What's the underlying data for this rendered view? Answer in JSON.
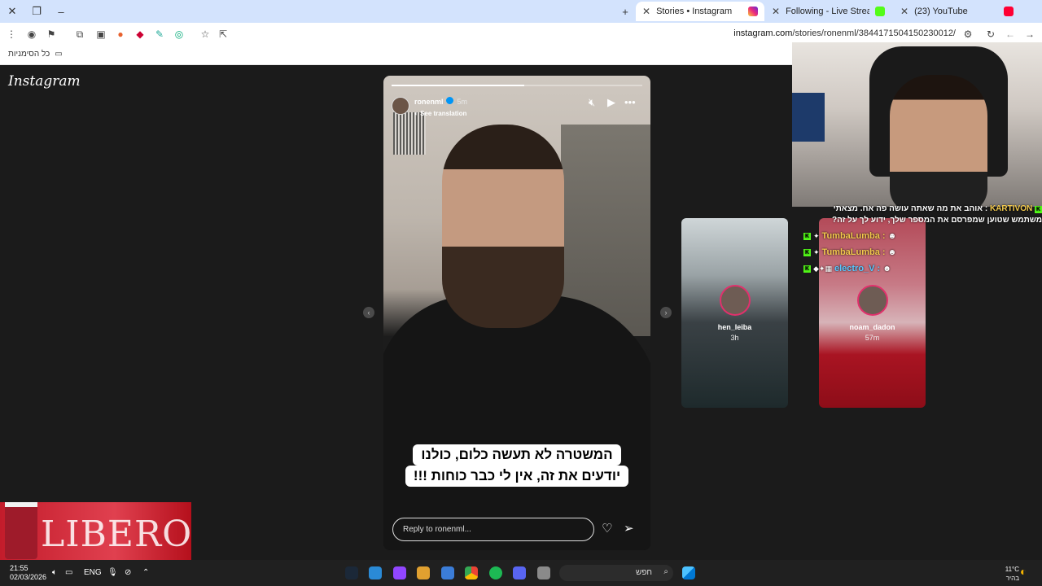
{
  "browser": {
    "tabs": [
      {
        "title": "Stories • Instagram",
        "active": true
      },
      {
        "title": "Following - Live Streams on Kic",
        "active": false
      },
      {
        "title": "(23) YouTube",
        "active": false
      }
    ],
    "new_tab_label": "+",
    "url_domain": "instagram.com",
    "url_path": "/stories/ronenml/3844171504150230012/",
    "bookmarks_label": "כל הסימניות"
  },
  "instagram": {
    "logo": "Instagram",
    "story": {
      "username": "ronenml",
      "time": "5m",
      "see_translation": "See translation",
      "progress": 0.53,
      "caption_line1": "המשטרה לא תעשה כלום, כולנו",
      "caption_line2": "יודעים את זה, אין לי כבר כוחות !!!",
      "reply_placeholder": "Reply to ronenml..."
    },
    "previews": [
      {
        "username": "hen_leiba",
        "time": "3h"
      },
      {
        "username": "noam_dadon",
        "time": "57m"
      }
    ]
  },
  "chat": {
    "message1_user": "KARTIVON",
    "message1_text": "אוהב את מה שאתה עושה פה אח. מצאתי משתמש שטוען שמפרסם את המספר שלך, ידוע לך על זה?",
    "rows": [
      {
        "user": "TumbaLumba :"
      },
      {
        "user": "TumbaLumba :"
      },
      {
        "user": "electro_V :"
      }
    ]
  },
  "ad": {
    "text": "LIBERO"
  },
  "taskbar": {
    "time": "21:55",
    "date": "02/03/2026",
    "lang": "ENG",
    "search_placeholder": "חפש",
    "weather_temp": "11°C",
    "weather_desc": "בהיר"
  },
  "colors": {
    "tabbar": "#d3e3fd",
    "page_bg": "#1b1b1b",
    "kick_green": "#53fc18",
    "verified_blue": "#0095f6"
  }
}
